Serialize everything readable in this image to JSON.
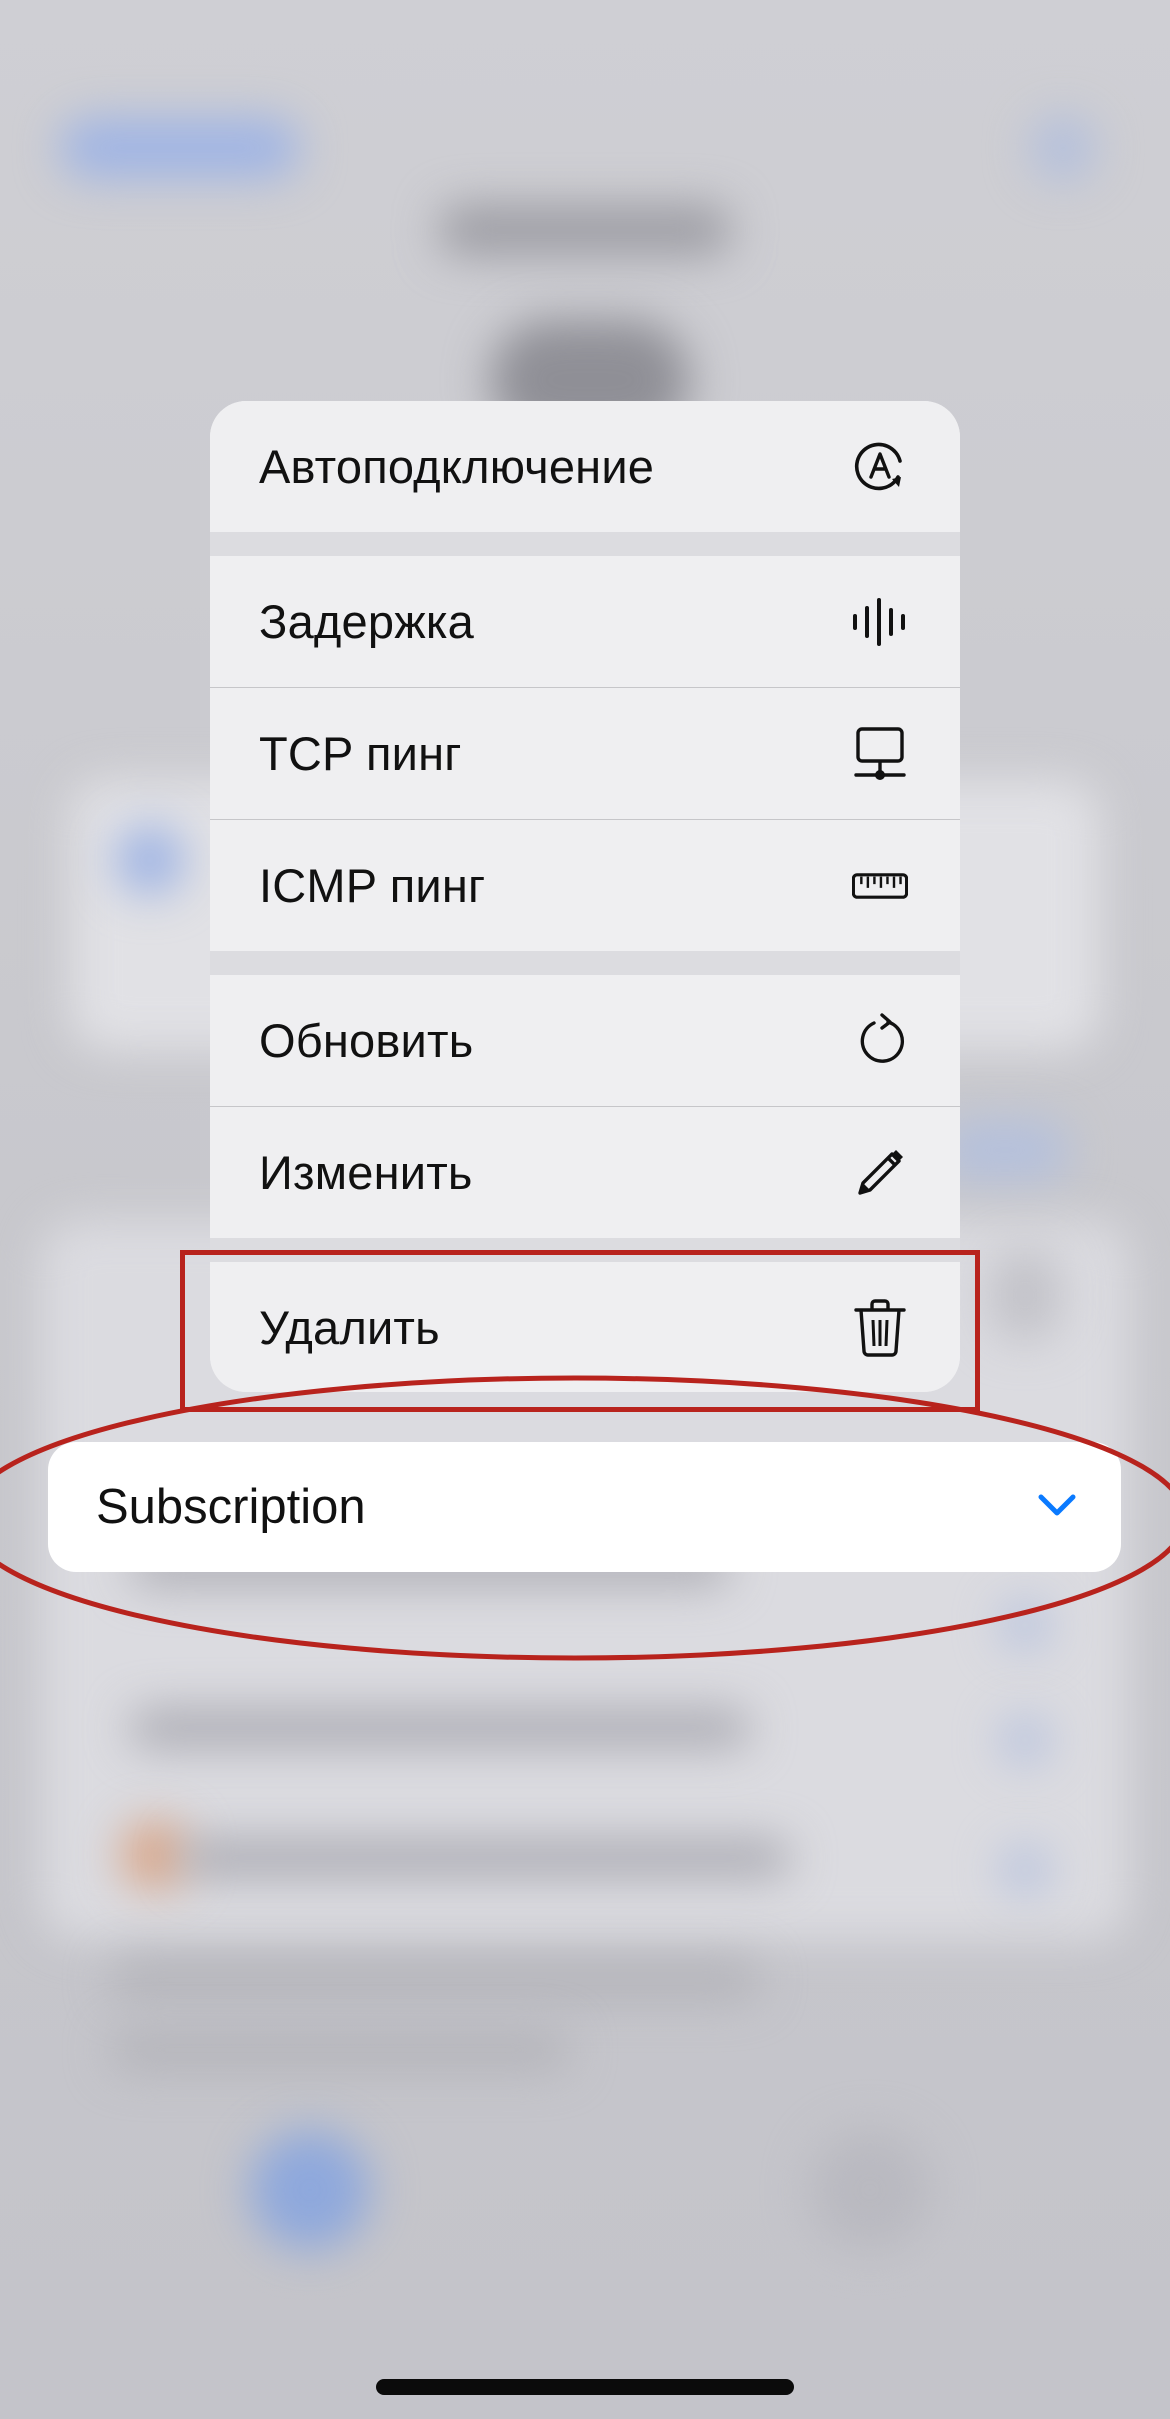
{
  "menu": {
    "items": [
      {
        "label": "Автоподключение",
        "icon": "auto-connect-icon"
      },
      {
        "label": "Задержка",
        "icon": "waveform-icon"
      },
      {
        "label": "TCP пинг",
        "icon": "network-computer-icon"
      },
      {
        "label": "ICMP пинг",
        "icon": "ruler-icon"
      },
      {
        "label": "Обновить",
        "icon": "refresh-icon"
      },
      {
        "label": "Изменить",
        "icon": "pencil-icon"
      },
      {
        "label": "Удалить",
        "icon": "trash-icon"
      }
    ]
  },
  "subscription": {
    "label": "Subscription",
    "icon": "chevron-down-icon"
  },
  "colors": {
    "menu_bg": "#efeff1",
    "accent_blue": "#0a7aff",
    "annotation_red": "#b8231d"
  }
}
